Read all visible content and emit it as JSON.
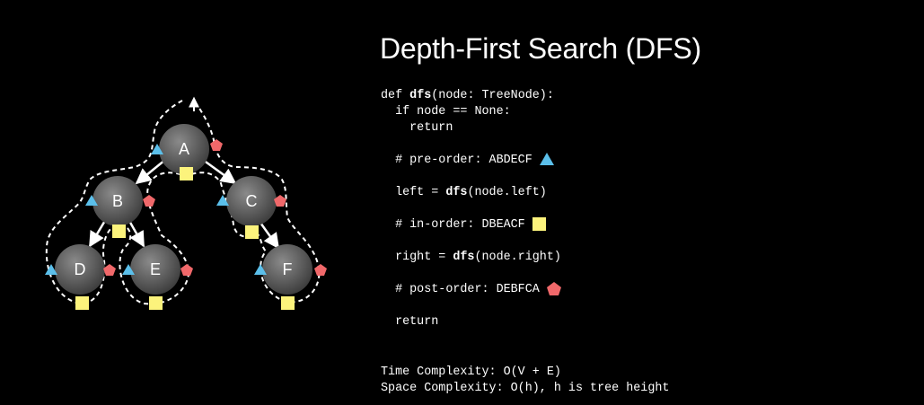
{
  "title": "Depth-First Search (DFS)",
  "tree": {
    "nodes": [
      "A",
      "B",
      "C",
      "D",
      "E",
      "F"
    ],
    "edges": [
      [
        "A",
        "B"
      ],
      [
        "A",
        "C"
      ],
      [
        "B",
        "D"
      ],
      [
        "B",
        "E"
      ],
      [
        "C",
        "F"
      ]
    ],
    "markers": {
      "pre_order": "blue-triangle",
      "in_order": "yellow-square",
      "post_order": "red-pentagon"
    },
    "colors": {
      "node_fill": "#5a5a5a",
      "pre_order": "#5bbfea",
      "in_order": "#fcf37c",
      "post_order": "#f0686a"
    }
  },
  "code": {
    "line1_prefix": "def ",
    "line1_fn": "dfs",
    "line1_rest": "(node: TreeNode):",
    "line2": "  if node == None:",
    "line3": "    return",
    "preorder_comment": "  # pre-order: ABDECF",
    "left_prefix": "  left = ",
    "left_fn": "dfs",
    "left_rest": "(node.left)",
    "inorder_comment": "  # in-order: DBEACF",
    "right_prefix": "  right = ",
    "right_fn": "dfs",
    "right_rest": "(node.right)",
    "postorder_comment": "  # post-order: DEBFCA",
    "return_line": "  return"
  },
  "complexity": {
    "time": "Time Complexity: O(V + E)",
    "space": "Space Complexity: O(h), h is tree height"
  }
}
